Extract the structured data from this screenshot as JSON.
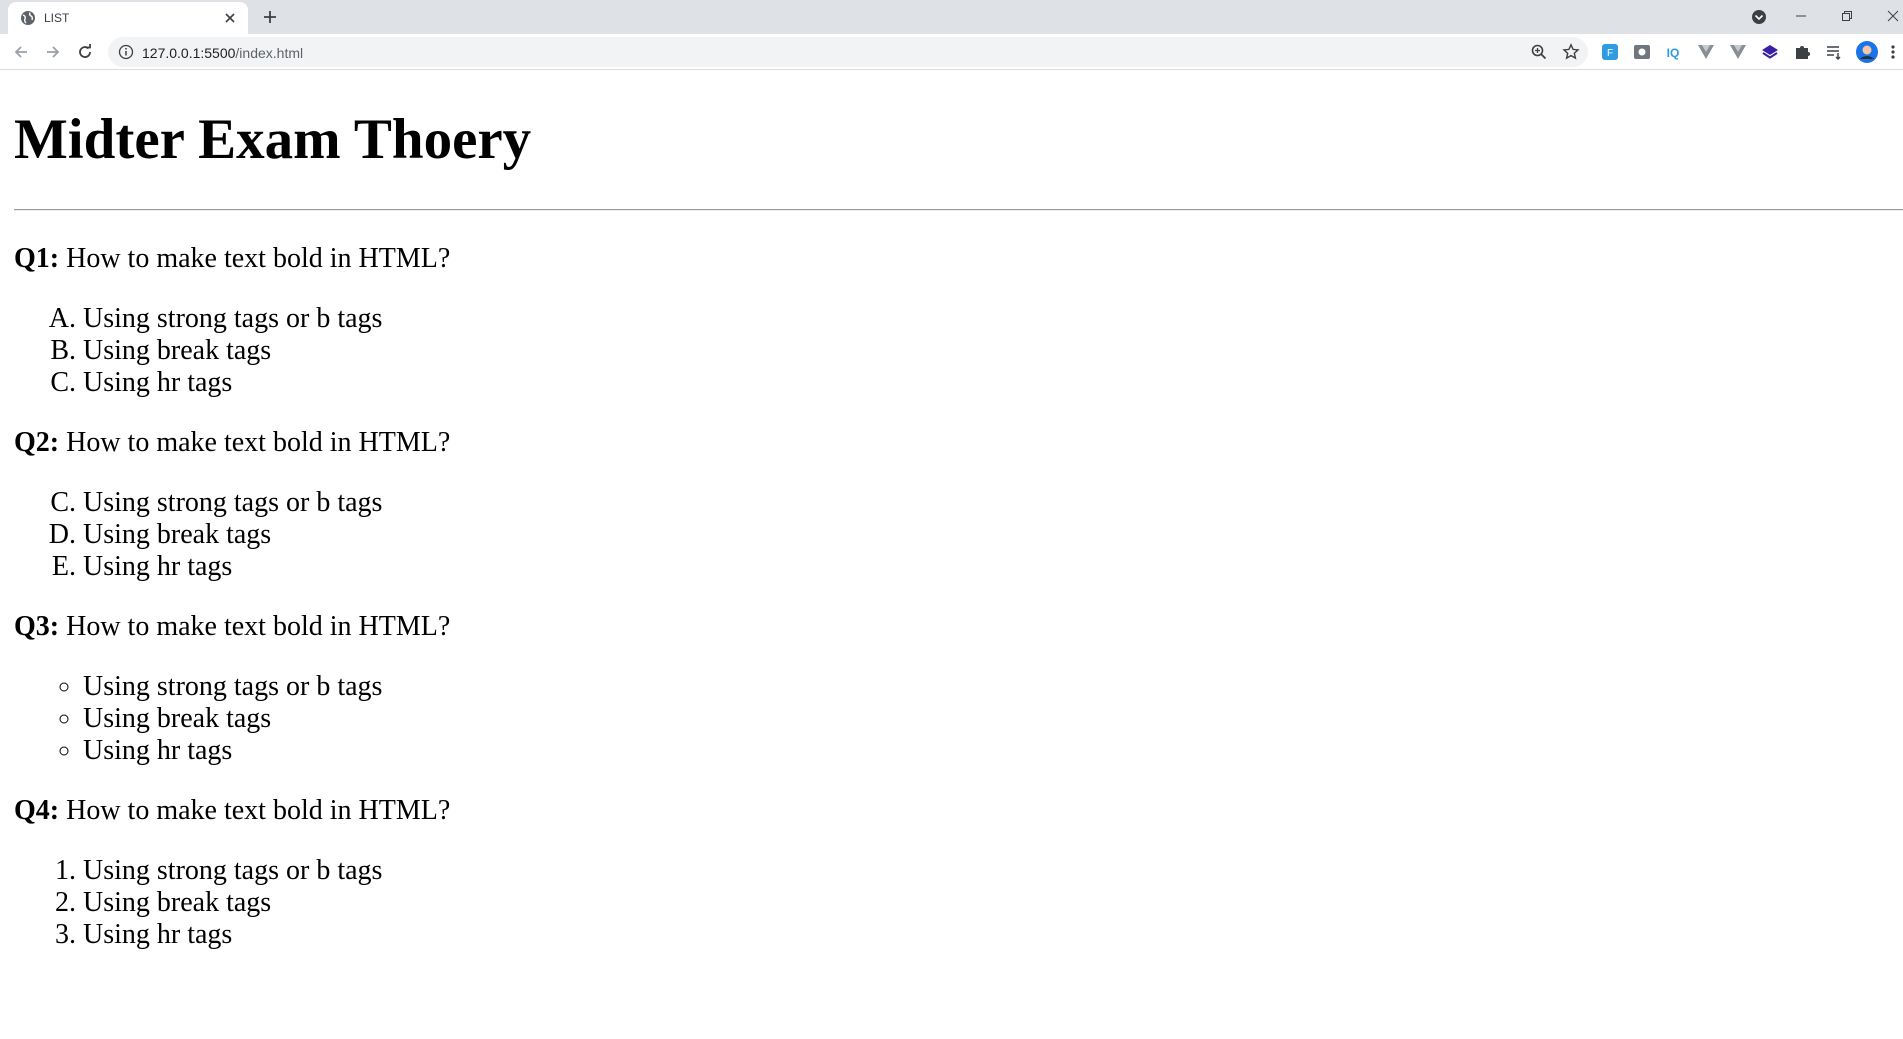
{
  "browser": {
    "tab_title": "LIST",
    "url_host": "127.0.0.1:5500",
    "url_path": "/index.html"
  },
  "page": {
    "heading": "Midter Exam Thoery",
    "questions": [
      {
        "label": "Q1:",
        "text": " How to make text bold in HTML?",
        "list_style": "upper-alpha",
        "start": 1,
        "answers": [
          "Using strong tags or b tags",
          "Using break tags",
          "Using hr tags"
        ]
      },
      {
        "label": "Q2:",
        "text": " How to make text bold in HTML?",
        "list_style": "upper-alpha",
        "start": 3,
        "answers": [
          "Using strong tags or b tags",
          "Using break tags",
          "Using hr tags"
        ]
      },
      {
        "label": "Q3:",
        "text": " How to make text bold in HTML?",
        "list_style": "circle",
        "answers": [
          "Using strong tags or b tags",
          "Using break tags",
          "Using hr tags"
        ]
      },
      {
        "label": "Q4:",
        "text": " How to make text bold in HTML?",
        "list_style": "decimal",
        "start": 1,
        "answers": [
          "Using strong tags or b tags",
          "Using break tags",
          "Using hr tags"
        ]
      }
    ]
  },
  "colors": {
    "tabstrip": "#dee1e6",
    "omnibox": "#f1f3f4",
    "text": "#000000"
  }
}
